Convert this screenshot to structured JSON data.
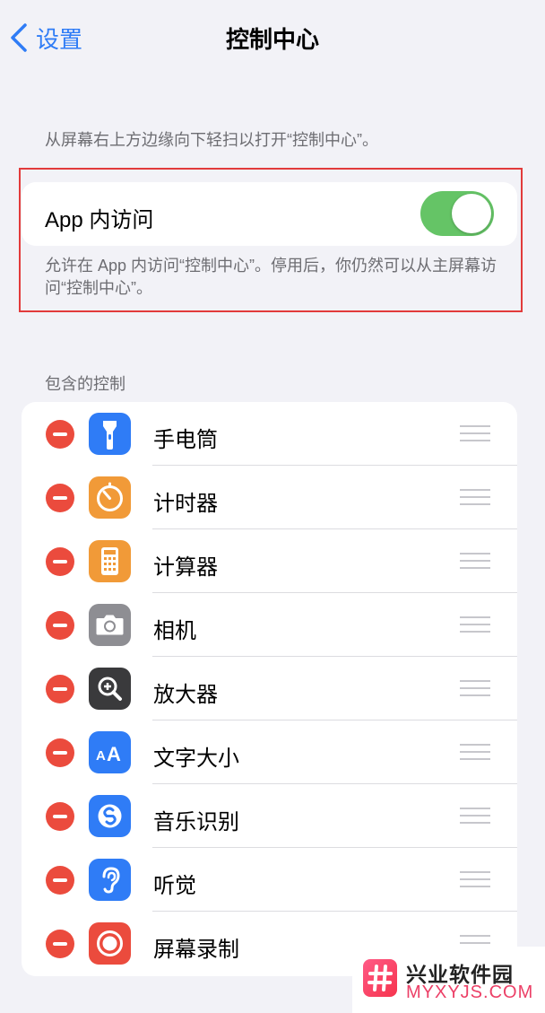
{
  "nav": {
    "back_label": "设置",
    "title": "控制中心"
  },
  "hint": "从屏幕右上方边缘向下轻扫以打开“控制中心”。",
  "app_access": {
    "label": "App 内访问",
    "enabled": true,
    "footer": "允许在 App 内访问“控制中心”。停用后，你仍然可以从主屏幕访问“控制中心”。"
  },
  "included": {
    "header": "包含的控制",
    "items": [
      {
        "label": "手电筒",
        "icon": "flashlight-icon",
        "color": "#2f7cf6"
      },
      {
        "label": "计时器",
        "icon": "timer-icon",
        "color": "#f19a38"
      },
      {
        "label": "计算器",
        "icon": "calculator-icon",
        "color": "#f19a38"
      },
      {
        "label": "相机",
        "icon": "camera-icon",
        "color": "#8e8e93"
      },
      {
        "label": "放大器",
        "icon": "magnifier-icon",
        "color": "#3a3a3c"
      },
      {
        "label": "文字大小",
        "icon": "text-size-icon",
        "color": "#2f7cf6"
      },
      {
        "label": "音乐识别",
        "icon": "shazam-icon",
        "color": "#2f7cf6"
      },
      {
        "label": "听觉",
        "icon": "hearing-icon",
        "color": "#2f7cf6"
      },
      {
        "label": "屏幕录制",
        "icon": "screen-record-icon",
        "color": "#eb4b3d"
      }
    ]
  },
  "watermark": {
    "title": "兴业软件园",
    "url": "MYXYJS.COM"
  }
}
